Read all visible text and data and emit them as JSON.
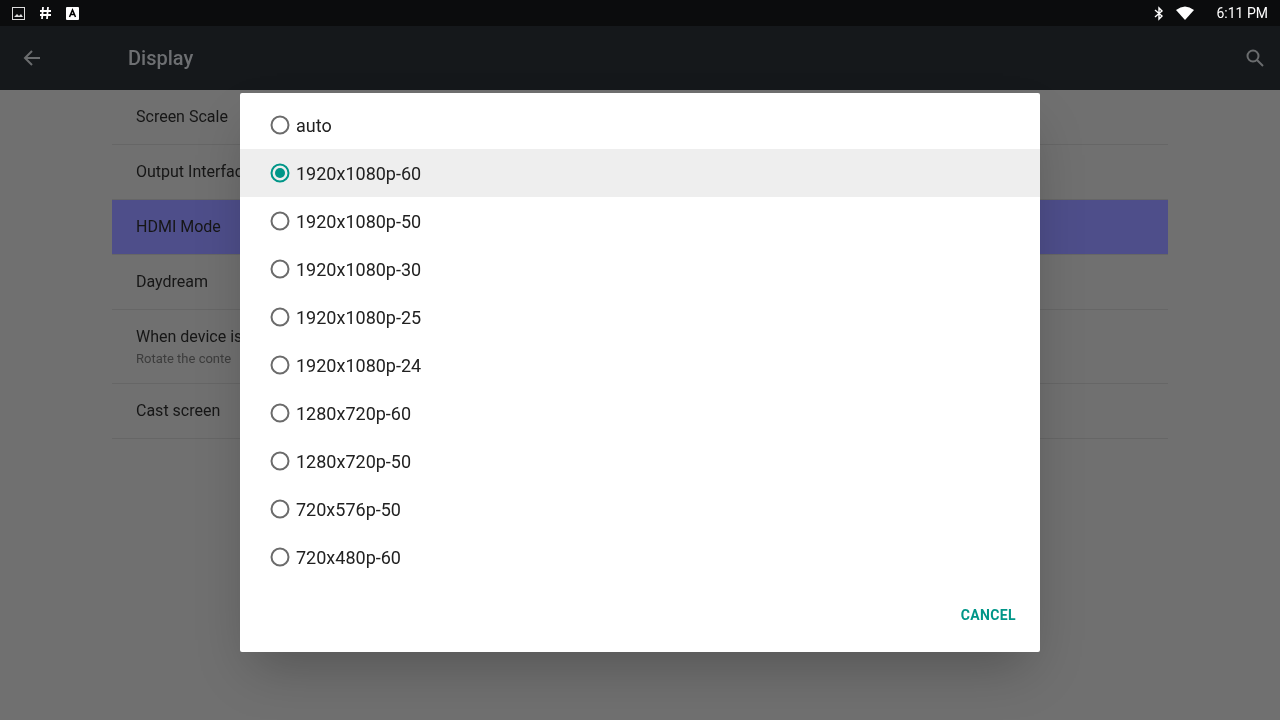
{
  "status_bar": {
    "time": "6:11 PM"
  },
  "app_bar": {
    "title": "Display"
  },
  "settings": [
    {
      "title": "Screen Scale",
      "selected": false
    },
    {
      "title": "Output Interfac",
      "selected": false
    },
    {
      "title": "HDMI Mode",
      "selected": true
    },
    {
      "title": "Daydream",
      "selected": false
    },
    {
      "title": "When device is",
      "summary": "Rotate the conte",
      "selected": false
    },
    {
      "title": "Cast screen",
      "selected": false
    }
  ],
  "dialog": {
    "options": [
      {
        "label": "auto",
        "selected": false
      },
      {
        "label": "1920x1080p-60",
        "selected": true
      },
      {
        "label": "1920x1080p-50",
        "selected": false
      },
      {
        "label": "1920x1080p-30",
        "selected": false
      },
      {
        "label": "1920x1080p-25",
        "selected": false
      },
      {
        "label": "1920x1080p-24",
        "selected": false
      },
      {
        "label": "1280x720p-60",
        "selected": false
      },
      {
        "label": "1280x720p-50",
        "selected": false
      },
      {
        "label": "720x576p-50",
        "selected": false
      },
      {
        "label": "720x480p-60",
        "selected": false
      }
    ],
    "button": "CANCEL"
  }
}
